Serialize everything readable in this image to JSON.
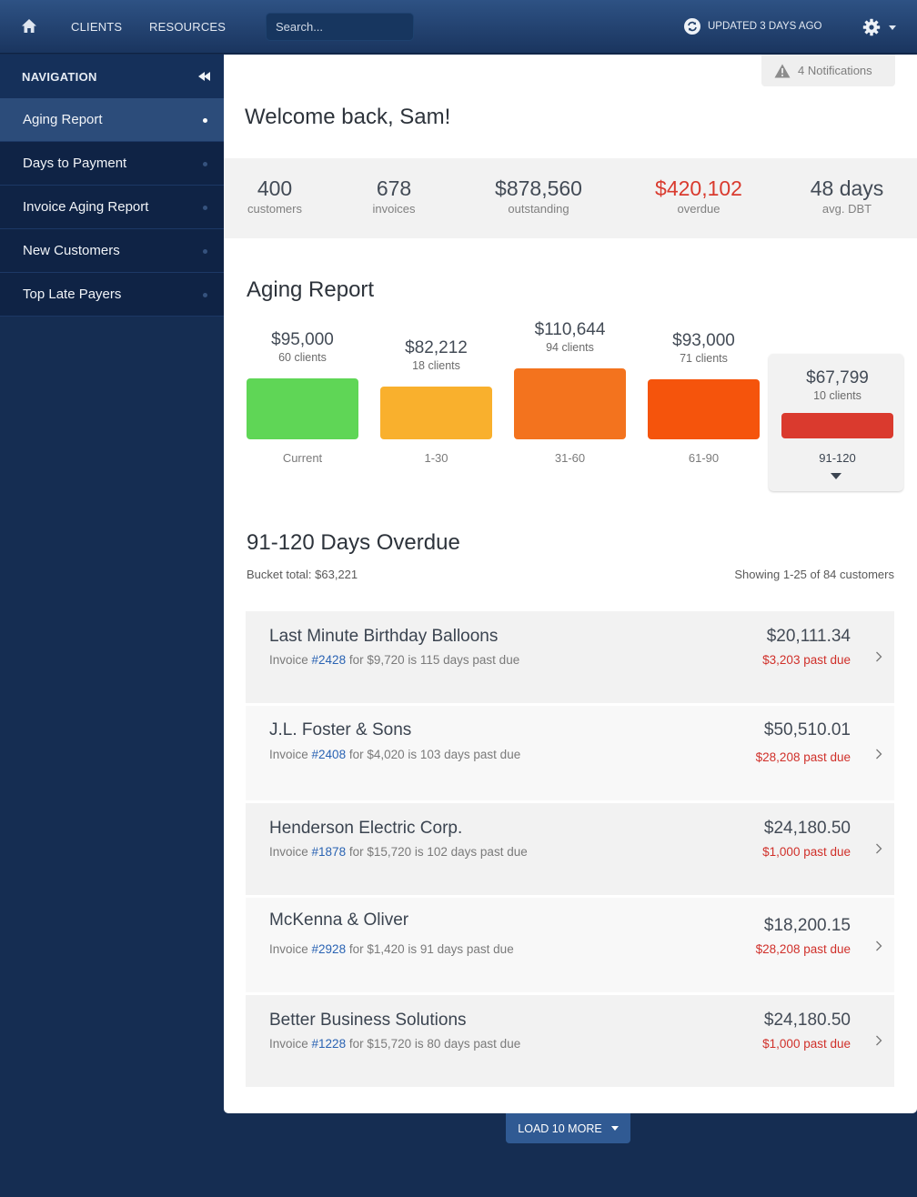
{
  "topbar": {
    "nav": [
      {
        "label": "CLIENTS"
      },
      {
        "label": "RESOURCES"
      }
    ],
    "search_placeholder": "Search...",
    "updated": "UPDATED 3 DAYS AGO",
    "icons": {
      "home": "home-icon",
      "refresh": "refresh-icon",
      "settings": "gear-icon"
    }
  },
  "sidebar": {
    "header": "NAVIGATION",
    "items": [
      {
        "label": "Aging Report",
        "active": true
      },
      {
        "label": "Days to Payment",
        "active": false
      },
      {
        "label": "Invoice Aging Report",
        "active": false
      },
      {
        "label": "New Customers",
        "active": false
      },
      {
        "label": "Top Late Payers",
        "active": false
      }
    ]
  },
  "main": {
    "notifications": "4 Notifications",
    "welcome": "Welcome back, Sam!",
    "stats": [
      {
        "value": "400",
        "caption": "customers",
        "highlight": false
      },
      {
        "value": "678",
        "caption": "invoices",
        "highlight": false
      },
      {
        "value": "$878,560",
        "caption": "outstanding",
        "highlight": false
      },
      {
        "value": "$420,102",
        "caption": "overdue",
        "highlight": true
      },
      {
        "value": "48 days",
        "caption": "avg. DBT",
        "highlight": false
      }
    ],
    "aging_title": "Aging Report",
    "buckets": [
      {
        "amount": "$95,000",
        "clients": "60 clients",
        "label": "Current",
        "value": 95000,
        "color": "#5fd656",
        "selected": false
      },
      {
        "amount": "$82,212",
        "clients": "18 clients",
        "label": "1-30",
        "value": 82212,
        "color": "#f9b02d",
        "selected": false
      },
      {
        "amount": "$110,644",
        "clients": "94 clients",
        "label": "31-60",
        "value": 110644,
        "color": "#f3731e",
        "selected": false
      },
      {
        "amount": "$93,000",
        "clients": "71 clients",
        "label": "61-90",
        "value": 93000,
        "color": "#f5540c",
        "selected": false
      },
      {
        "amount": "$67,799",
        "clients": "10 clients",
        "label": "91-120",
        "value": 67799,
        "color": "#da3a2e",
        "selected": true
      }
    ],
    "detail_title": "91-120 Days Overdue",
    "bucket_total": "Bucket total: $63,221",
    "showing": "Showing 1-25 of 84 customers",
    "rows": [
      {
        "name": "Last Minute Birthday Balloons",
        "desc_prefix": "Invoice ",
        "invoice": "#2428",
        "desc_suffix": " for $9,720 is 115 days past due",
        "amount": "$20,111.34",
        "past_due": "$3,203 past due"
      },
      {
        "name": "J.L. Foster & Sons",
        "desc_prefix": "Invoice ",
        "invoice": "#2408",
        "desc_suffix": " for $4,020 is 103 days past due",
        "amount": "$50,510.01",
        "past_due": "$28,208 past due"
      },
      {
        "name": "Henderson Electric Corp.",
        "desc_prefix": "Invoice ",
        "invoice": "#1878",
        "desc_suffix": " for $15,720 is 102 days past due",
        "amount": "$24,180.50",
        "past_due": "$1,000 past due"
      },
      {
        "name": "McKenna & Oliver",
        "desc_prefix": "Invoice ",
        "invoice": "#2928",
        "desc_suffix": " for $1,420 is 91 days past due",
        "amount": "$18,200.15",
        "past_due": "$28,208 past due"
      },
      {
        "name": "Better Business Solutions",
        "desc_prefix": "Invoice ",
        "invoice": "#1228",
        "desc_suffix": " for $15,720 is 80 days past due",
        "amount": "$24,180.50",
        "past_due": "$1,000 past due"
      }
    ],
    "load_more": "LOAD 10 MORE"
  },
  "chart_data": {
    "type": "bar",
    "title": "Aging Report",
    "categories": [
      "Current",
      "1-30",
      "31-60",
      "61-90",
      "91-120"
    ],
    "values": [
      95000,
      82212,
      110644,
      93000,
      67799
    ],
    "clients": [
      60,
      18,
      94,
      71,
      10
    ],
    "colors": [
      "#5fd656",
      "#f9b02d",
      "#f3731e",
      "#f5540c",
      "#da3a2e"
    ],
    "selected": "91-120",
    "xlabel": "",
    "ylabel": ""
  }
}
